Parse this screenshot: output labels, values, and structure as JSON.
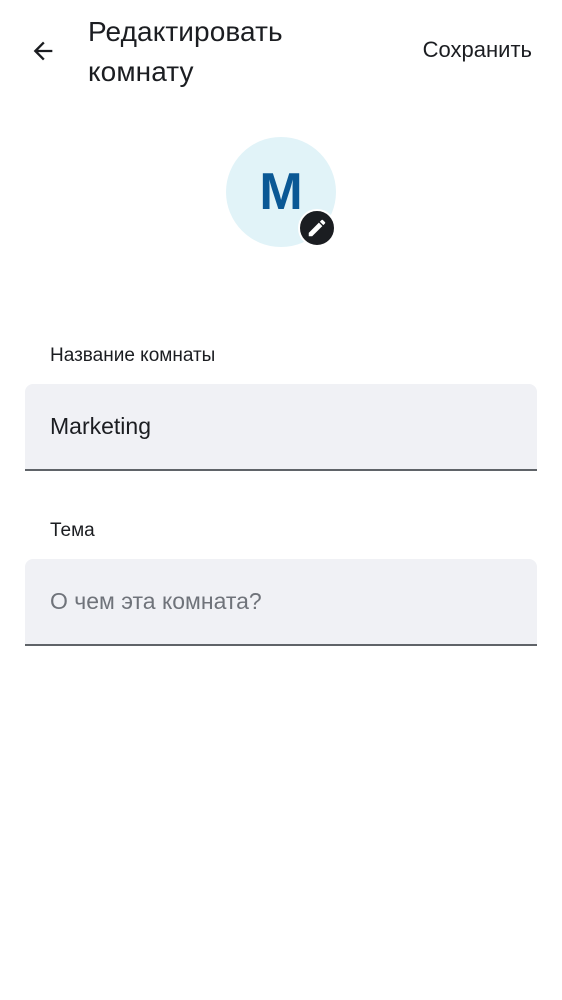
{
  "header": {
    "title": "Редактировать комнату",
    "save_label": "Сохранить"
  },
  "avatar": {
    "initial": "M"
  },
  "fields": {
    "name": {
      "label": "Название комнаты",
      "value": "Marketing"
    },
    "topic": {
      "label": "Тема",
      "value": "",
      "placeholder": "О чем эта комната?"
    }
  },
  "icons": {
    "back": "arrow-left-icon",
    "edit": "pencil-icon"
  },
  "colors": {
    "avatar_bg": "#e1f3f8",
    "avatar_text": "#0a5895",
    "field_bg": "#f0f1f5",
    "text": "#1b1d21"
  }
}
